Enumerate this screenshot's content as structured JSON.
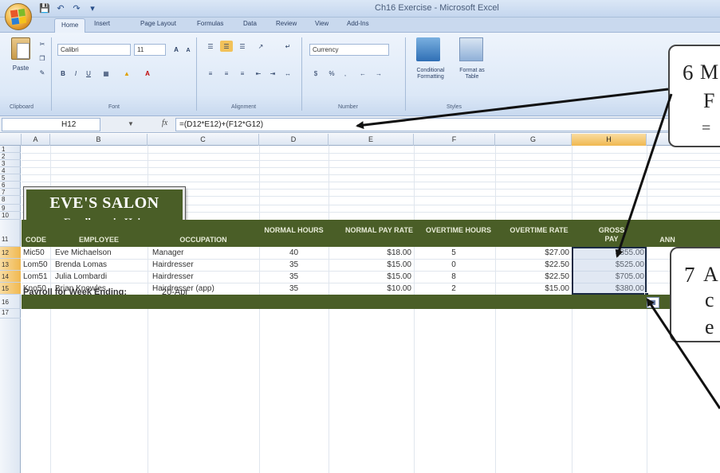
{
  "window": {
    "title": "Ch16 Exercise - Microsoft Excel",
    "quick_access": [
      "save-icon",
      "undo-icon",
      "redo-icon",
      "customize-icon"
    ]
  },
  "ribbon_tabs": [
    "Home",
    "Insert",
    "Page Layout",
    "Formulas",
    "Data",
    "Review",
    "View",
    "Add-Ins"
  ],
  "ribbon": {
    "clipboard": {
      "paste": "Paste",
      "label": "Clipboard"
    },
    "font": {
      "name": "Calibri",
      "size": "11",
      "bold": "B",
      "italic": "I",
      "underline": "U",
      "grow": "A",
      "shrink": "A",
      "label": "Font"
    },
    "alignment": {
      "label": "Alignment"
    },
    "number": {
      "format": "Currency",
      "currency": "$",
      "percent": "%",
      "comma": ",",
      "label": "Number"
    },
    "styles": {
      "conditional": "Conditional Formatting",
      "format_table": "Format as Table",
      "label": "Styles"
    }
  },
  "formula_bar": {
    "name_box": "H12",
    "fx": "fx",
    "formula": "=(D12*E12)+(F12*G12)"
  },
  "columns": [
    "A",
    "B",
    "C",
    "D",
    "E",
    "F",
    "G",
    "H"
  ],
  "rows": [
    "1",
    "2",
    "3",
    "4",
    "5",
    "6",
    "7",
    "8",
    "9",
    "10",
    "11",
    "12",
    "13",
    "14",
    "15",
    "16",
    "17"
  ],
  "sheet": {
    "logo_title": "EVE'S SALON",
    "logo_subtitle": "Excellence in Hair",
    "payroll_label": "Payroll for Week Ending:",
    "payroll_date": "20-Apr",
    "headers": {
      "code": "CODE",
      "employee": "EMPLOYEE",
      "occupation": "OCCUPATION",
      "normal_hours": "NORMAL HOURS",
      "normal_rate": "NORMAL PAY RATE",
      "overtime_hours": "OVERTIME HOURS",
      "overtime_rate": "OVERTIME RATE",
      "gross_pay": "GROSS PAY",
      "annual": "ANN"
    },
    "data_rows": [
      {
        "code": "Mic50",
        "employee": "Eve Michaelson",
        "occupation": "Manager",
        "hours": "40",
        "rate": "$18.00",
        "ot_hours": "5",
        "ot_rate": "$27.00",
        "gross": "$855.00"
      },
      {
        "code": "Lom50",
        "employee": "Brenda Lomas",
        "occupation": "Hairdresser",
        "hours": "35",
        "rate": "$15.00",
        "ot_hours": "0",
        "ot_rate": "$22.50",
        "gross": "$525.00"
      },
      {
        "code": "Lom51",
        "employee": "Julia Lombardi",
        "occupation": "Hairdresser",
        "hours": "35",
        "rate": "$15.00",
        "ot_hours": "8",
        "ot_rate": "$22.50",
        "gross": "$705.00"
      },
      {
        "code": "Kno50",
        "employee": "Brian Knowles",
        "occupation": "Hairdresser (app)",
        "hours": "35",
        "rate": "$10.00",
        "ot_hours": "2",
        "ot_rate": "$15.00",
        "gross": "$380.00"
      }
    ]
  },
  "callouts": {
    "step6": {
      "number": "6",
      "line1": "M",
      "line2": "F",
      "line3": "="
    },
    "step7": {
      "number": "7",
      "line1": "A",
      "line2": "c",
      "line3": "e"
    }
  },
  "colors": {
    "header_green": "#4a5e27",
    "ribbon_blue": "#dce8f7",
    "selection_border": "#1b2a44"
  }
}
